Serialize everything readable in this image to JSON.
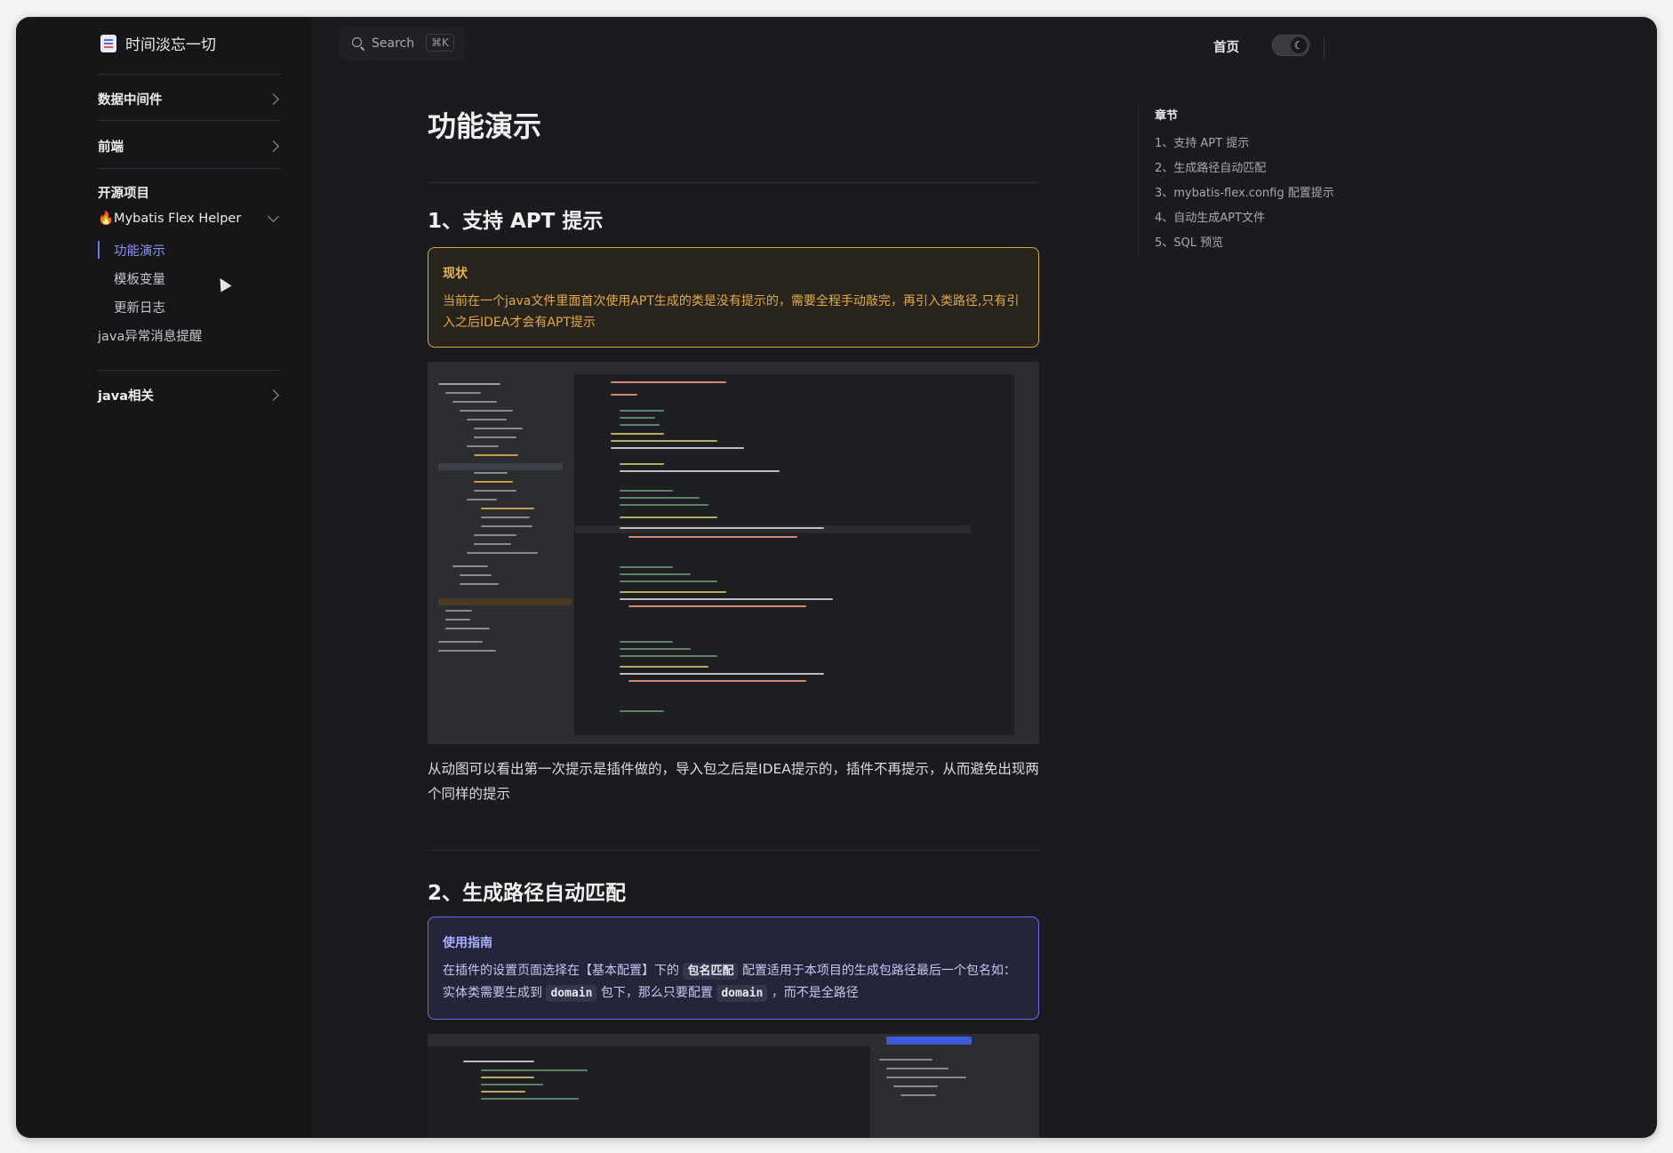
{
  "site": {
    "title": "时间淡忘一切"
  },
  "sidebar": {
    "groups": [
      {
        "label": "数据中间件"
      },
      {
        "label": "前端"
      }
    ],
    "open_section": {
      "title": "开源项目",
      "sub_group": "🔥Mybatis Flex Helper",
      "items": [
        "功能演示",
        "模板变量",
        "更新日志"
      ],
      "extra_item": "java异常消息提醒"
    },
    "bottom_group": "java相关"
  },
  "topbar": {
    "search_label": "Search",
    "search_shortcut": "⌘K",
    "nav_home": "首页",
    "theme_icon": "moon-icon"
  },
  "content": {
    "title": "功能演示",
    "section1": {
      "heading": "1、支持 APT 提示",
      "callout_title": "现状",
      "callout_text": "当前在一个java文件里面首次使用APT生成的类是没有提示的，需要全程手动敲完，再引入类路径,只有引入之后IDEA才会有APT提示",
      "paragraph": "从动图可以看出第一次提示是插件做的，导入包之后是IDEA提示的，插件不再提示，从而避免出现两个同样的提示"
    },
    "section2": {
      "heading": "2、生成路径自动匹配",
      "callout_title": "使用指南",
      "callout_text_1": "在插件的设置页面选择在【基本配置】下的",
      "code_1": "包名匹配",
      "callout_text_2": "配置适用于本项目的生成包路径最后一个包名如：实体类需要生成到",
      "code_2": "domain",
      "callout_text_3": "包下，那么只要配置",
      "code_3": "domain",
      "callout_text_4": "，而不是全路径"
    }
  },
  "toc": {
    "title": "章节",
    "items": [
      "1、支持 APT 提示",
      "2、生成路径自动匹配",
      "3、mybatis-flex.config 配置提示",
      "4、自动生成APT文件",
      "5、SQL 预览"
    ]
  },
  "colors": {
    "accent": "#6f78ea",
    "warning": "#d8a63a",
    "tip": "#6a6cf0"
  }
}
